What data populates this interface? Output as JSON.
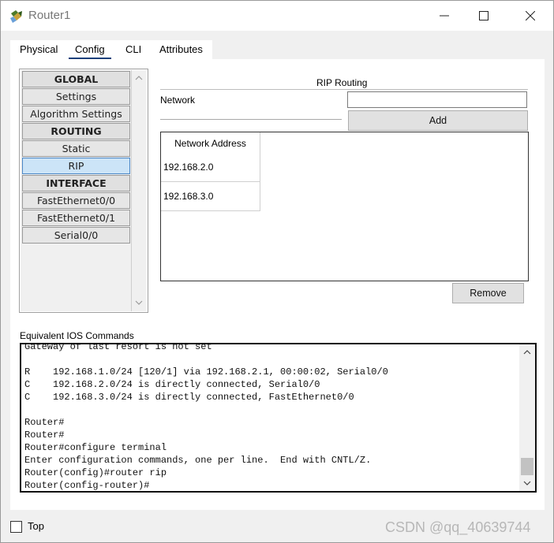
{
  "window": {
    "title": "Router1"
  },
  "tabs": [
    "Physical",
    "Config",
    "CLI",
    "Attributes"
  ],
  "active_tab": "Config",
  "nav": {
    "items": [
      {
        "label": "GLOBAL",
        "kind": "header"
      },
      {
        "label": "Settings",
        "kind": "item"
      },
      {
        "label": "Algorithm Settings",
        "kind": "item"
      },
      {
        "label": "ROUTING",
        "kind": "header"
      },
      {
        "label": "Static",
        "kind": "item"
      },
      {
        "label": "RIP",
        "kind": "item",
        "selected": true
      },
      {
        "label": "INTERFACE",
        "kind": "header"
      },
      {
        "label": "FastEthernet0/0",
        "kind": "item"
      },
      {
        "label": "FastEthernet0/1",
        "kind": "item"
      },
      {
        "label": "Serial0/0",
        "kind": "item"
      }
    ]
  },
  "rip": {
    "title": "RIP Routing",
    "network_label": "Network",
    "network_value": "",
    "add_label": "Add",
    "table_header": "Network Address",
    "networks": [
      "192.168.2.0",
      "192.168.3.0"
    ],
    "remove_label": "Remove"
  },
  "ios": {
    "label": "Equivalent IOS Commands",
    "lines": [
      "Gateway of last resort is not set",
      "",
      "R    192.168.1.0/24 [120/1] via 192.168.2.1, 00:00:02, Serial0/0",
      "C    192.168.2.0/24 is directly connected, Serial0/0",
      "C    192.168.3.0/24 is directly connected, FastEthernet0/0",
      "",
      "Router#",
      "Router#",
      "Router#configure terminal",
      "Enter configuration commands, one per line.  End with CNTL/Z.",
      "Router(config)#router rip",
      "Router(config-router)#"
    ]
  },
  "footer": {
    "top_label": "Top",
    "top_checked": false,
    "watermark": "CSDN @qq_40639744"
  },
  "icons": {
    "app": "router-app-icon",
    "minimize": "minimize-icon",
    "maximize": "maximize-icon",
    "close": "close-icon"
  },
  "colors": {
    "selected_bg": "#cce4f7",
    "active_tab_underline": "#1a3f7a"
  }
}
